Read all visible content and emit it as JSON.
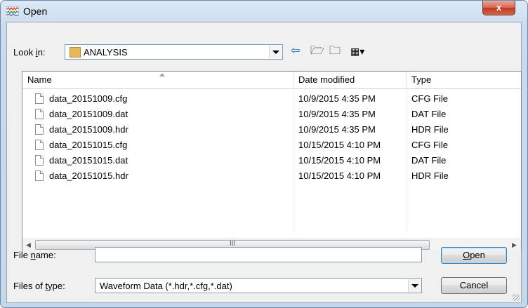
{
  "window": {
    "title": "Open",
    "close_label": "x"
  },
  "look_in": {
    "label_pre": "Look ",
    "label_u": "i",
    "label_post": "n:",
    "value": "ANALYSIS"
  },
  "toolbar": {
    "back_glyph": "⇦",
    "up_glyph": "🗁",
    "new_folder_glyph": "🗀",
    "view_glyph": "▦▾"
  },
  "columns": {
    "name": "Name",
    "date": "Date modified",
    "type": "Type"
  },
  "files": [
    {
      "name": "data_20151009.cfg",
      "date": "10/9/2015 4:35 PM",
      "type": "CFG File"
    },
    {
      "name": "data_20151009.dat",
      "date": "10/9/2015 4:35 PM",
      "type": "DAT File"
    },
    {
      "name": "data_20151009.hdr",
      "date": "10/9/2015 4:35 PM",
      "type": "HDR File"
    },
    {
      "name": "data_20151015.cfg",
      "date": "10/15/2015 4:10 PM",
      "type": "CFG File"
    },
    {
      "name": "data_20151015.dat",
      "date": "10/15/2015 4:10 PM",
      "type": "DAT File"
    },
    {
      "name": "data_20151015.hdr",
      "date": "10/15/2015 4:10 PM",
      "type": "HDR File"
    }
  ],
  "scrollbar": {
    "grip": "III",
    "left": "◀",
    "right": "▶"
  },
  "file_name": {
    "label_pre": "File ",
    "label_u": "n",
    "label_post": "ame:",
    "value": ""
  },
  "file_type": {
    "label_pre": "Files of ",
    "label_u": "t",
    "label_post": "ype:",
    "value": "Waveform  Data (*.hdr,*.cfg,*.dat)"
  },
  "buttons": {
    "open_u": "O",
    "open_rest": "pen",
    "cancel": "Cancel"
  }
}
